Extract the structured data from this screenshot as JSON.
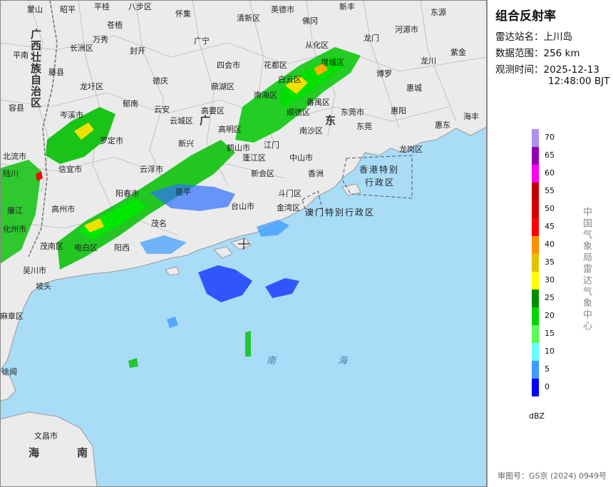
{
  "panel": {
    "title": "组合反射率",
    "station_label": "雷达站名：",
    "station_value": "上川岛",
    "range_label": "数据范围：",
    "range_value": "256 km",
    "time_label": "观测时间：",
    "time_date": "2025-12-13",
    "time_clock": "12:48:00 BJT"
  },
  "legend": {
    "unit": "dBZ",
    "ticks": [
      "70",
      "65",
      "60",
      "55",
      "50",
      "45",
      "40",
      "35",
      "30",
      "25",
      "20",
      "15",
      "10",
      "5",
      "0"
    ],
    "colors": [
      "#ad90f0",
      "#9600b4",
      "#ff00f0",
      "#c00000",
      "#d60000",
      "#ff0000",
      "#ff9000",
      "#e7c000",
      "#ffff00",
      "#009000",
      "#00d800",
      "#55ff55",
      "#66ffff",
      "#3c9bff",
      "#0000f6"
    ]
  },
  "agency": "中国气象局雷达气象中心",
  "approval": "审图号：GS京 (2024) 0949号",
  "map": {
    "province_labels": {
      "guangxi": "广西壮族自治区",
      "guangdong_1": "广",
      "guangdong_2": "东",
      "hainan_1": "海",
      "hainan_2": "南"
    },
    "sea_labels": {
      "south_1": "南",
      "south_2": "海"
    },
    "sar_labels": {
      "hongkong_1": "香港特别",
      "hongkong_2": "行政区",
      "macau": "澳门特别行政区"
    },
    "places": [
      "蒙山",
      "昭平",
      "平桂",
      "八步区",
      "怀集",
      "英德市",
      "新丰",
      "东源",
      "苍梧",
      "清新区",
      "佛冈",
      "龙门",
      "河源市",
      "长洲区",
      "万秀",
      "封开",
      "从化区",
      "紫金",
      "平南",
      "藤县",
      "四会市",
      "花都区",
      "增城区",
      "龙川",
      "龙圩区",
      "德庆",
      "广宁",
      "鼎湖区",
      "南海区",
      "白云区",
      "博罗",
      "惠城",
      "惠阳",
      "容县",
      "岑溪市",
      "郁南",
      "云城区",
      "罗定市",
      "云安",
      "高要区",
      "高明区",
      "东莞市",
      "海丰",
      "惠东",
      "北流市",
      "陆川",
      "信宜市",
      "新兴",
      "鹤山市",
      "江门",
      "中山市",
      "龙岗区",
      "新会区",
      "香洲",
      "高州市",
      "阳春市",
      "恩平",
      "台山市",
      "斗门区",
      "金湾区",
      "廉江",
      "化州市",
      "电白区",
      "阳西",
      "茂名",
      "茂南区",
      "吴川市",
      "麻章区",
      "徐闻",
      "文昌市",
      "东莞",
      "顺德区",
      "番禺区",
      "南沙区",
      "云浮市",
      "蓬江区",
      "坡头"
    ]
  }
}
